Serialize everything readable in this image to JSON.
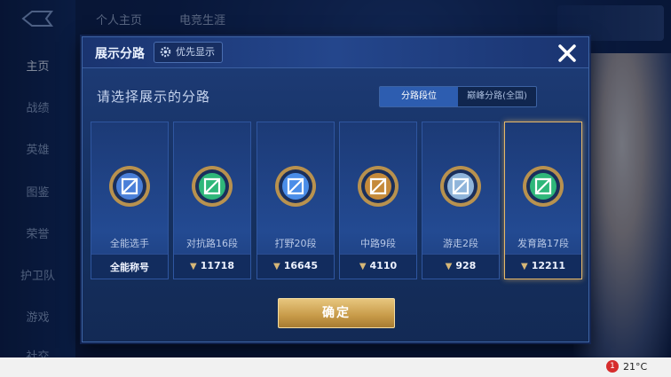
{
  "background": {
    "top_tabs": [
      "个人主页",
      "电竞生涯"
    ],
    "nav": [
      "主页",
      "战绩",
      "英雄",
      "图鉴",
      "荣誉",
      "护卫队",
      "游戏",
      "社交"
    ]
  },
  "dialog": {
    "title": "展示分路",
    "priority_label": "优先显示",
    "prompt": "请选择展示的分路",
    "segments": [
      {
        "label": "分路段位",
        "active": true
      },
      {
        "label": "巅峰分路(全国)",
        "active": false
      }
    ],
    "cards": [
      {
        "rank": "全能选手",
        "score": "全能称号",
        "show_arrow": false,
        "selected": false,
        "color": "#4a7fd8"
      },
      {
        "rank": "对抗路16段",
        "score": "11718",
        "show_arrow": true,
        "selected": false,
        "color": "#2fb77a"
      },
      {
        "rank": "打野20段",
        "score": "16645",
        "show_arrow": true,
        "selected": false,
        "color": "#4a8de8"
      },
      {
        "rank": "中路9段",
        "score": "4110",
        "show_arrow": true,
        "selected": false,
        "color": "#c58a3a"
      },
      {
        "rank": "游走2段",
        "score": "928",
        "show_arrow": true,
        "selected": false,
        "color": "#8fb4da"
      },
      {
        "rank": "发育路17段",
        "score": "12211",
        "show_arrow": true,
        "selected": true,
        "color": "#2fb77a"
      }
    ],
    "confirm_label": "确定"
  },
  "taskbar": {
    "notification_count": "1",
    "temperature": "21°C"
  }
}
